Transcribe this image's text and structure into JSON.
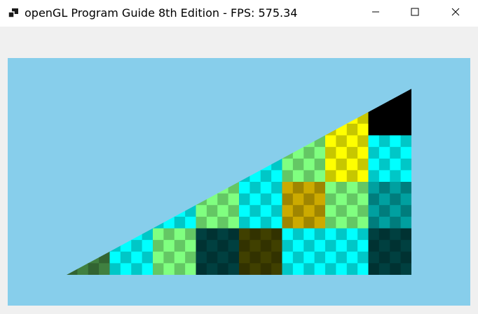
{
  "window": {
    "title": "openGL Program Guide 8th Edition - FPS: 575.34",
    "icon": "app-window-icon",
    "controls": [
      {
        "name": "minimize",
        "icon": "minimize-icon"
      },
      {
        "name": "maximize",
        "icon": "maximize-icon"
      },
      {
        "name": "close",
        "icon": "close-icon"
      }
    ]
  },
  "viewport": {
    "background_color": "#87ceeb",
    "shape": "right triangle",
    "palette": [
      "#000000",
      "#00ffff",
      "#ffff00"
    ],
    "grid_columns": 8,
    "grid_rows": 4
  }
}
